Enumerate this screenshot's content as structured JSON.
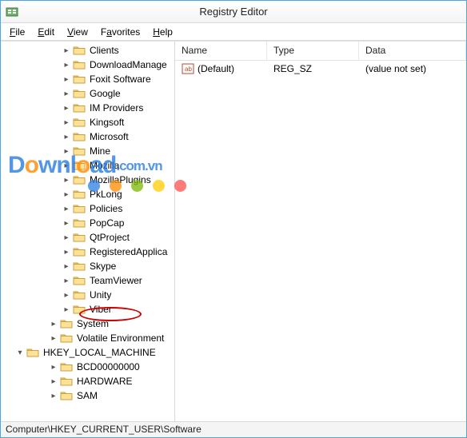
{
  "window": {
    "title": "Registry Editor"
  },
  "menu": {
    "file": "File",
    "edit": "Edit",
    "view": "View",
    "favorites": "Favorites",
    "help": "Help"
  },
  "columns": {
    "name": "Name",
    "type": "Type",
    "data": "Data"
  },
  "values": [
    {
      "name": "(Default)",
      "type": "REG_SZ",
      "data": "(value not set)"
    }
  ],
  "tree": {
    "software_children": [
      "Clients",
      "DownloadManager",
      "Foxit Software",
      "Google",
      "IM Providers",
      "Kingsoft",
      "Microsoft",
      "Mine",
      "Mozilla",
      "MozillaPlugins",
      "PkLong",
      "Policies",
      "PopCap",
      "QtProject",
      "RegisteredApplications",
      "Skype",
      "TeamViewer",
      "Unity",
      "Viber"
    ],
    "hkcu_tail": [
      "System",
      "Volatile Environment"
    ],
    "hklm": {
      "label": "HKEY_LOCAL_MACHINE",
      "children": [
        "BCD00000000",
        "HARDWARE",
        "SAM"
      ]
    }
  },
  "statusbar": "Computer\\HKEY_CURRENT_USER\\Software",
  "watermark": {
    "text_main": "Download",
    "text_ext": ".com.vn"
  }
}
